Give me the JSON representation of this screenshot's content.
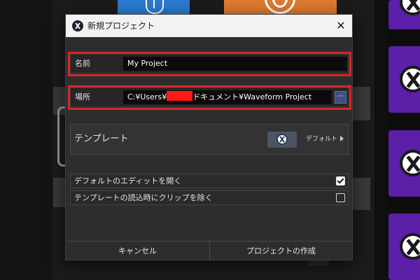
{
  "dialog": {
    "title": "新規プロジェクト",
    "close_icon": "close-icon",
    "name_label": "名前",
    "name_value": "My Project",
    "location_label": "場所",
    "location_prefix": "C:¥Users¥",
    "location_suffix": "ドキュメント¥Waveform Project",
    "browse_label": "···",
    "template_label": "テンプレート",
    "template_default": "デフォルト",
    "option_open_default_edit": "デフォルトのエディットを開く",
    "option_open_default_edit_checked": true,
    "option_remove_clips": "テンプレートの読込時にクリップを除く",
    "option_remove_clips_checked": false,
    "cancel_label": "キャンセル",
    "create_label": "プロジェクトの作成"
  },
  "colors": {
    "highlight": "#d7262b",
    "redaction": "#ff1a1a",
    "tile_purple": "#5b1fa8",
    "thumb_blue": "#2a7bd1",
    "thumb_orange": "#e07a2f"
  }
}
